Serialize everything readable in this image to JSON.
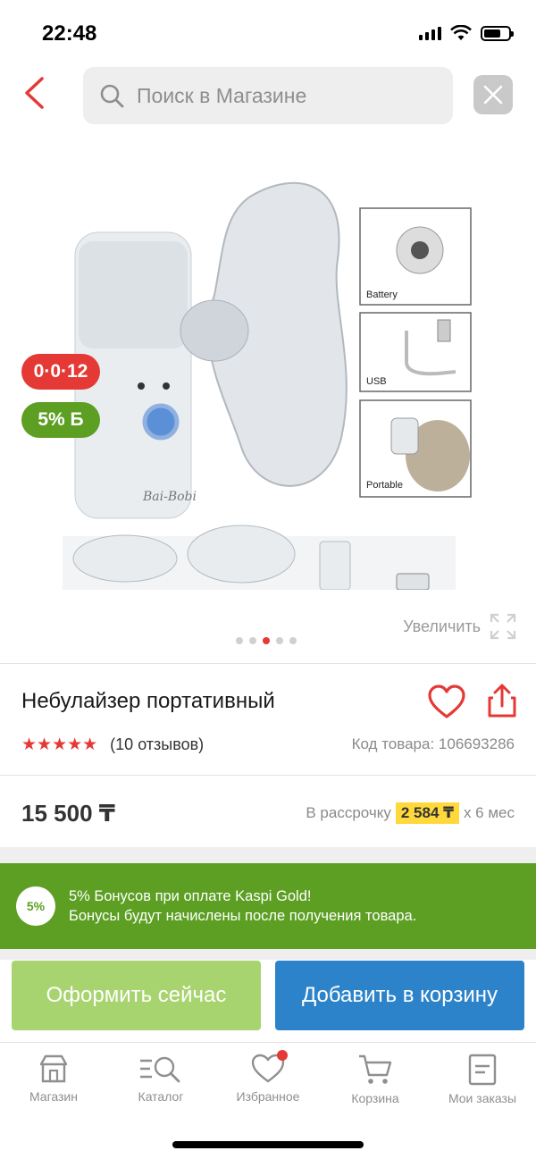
{
  "status_bar": {
    "time": "22:48"
  },
  "search": {
    "placeholder": "Поиск в Магазине"
  },
  "gallery": {
    "badge_installment": "0·0·12",
    "badge_bonus": "5% Б",
    "zoom_label": "Увеличить",
    "dots_total": 5,
    "dots_active": 3,
    "image_captions": [
      "Battery",
      "USB",
      "Portable"
    ],
    "brand_text": "Bai-Bobi"
  },
  "product": {
    "title": "Небулайзер портативный",
    "stars": "★★★★★",
    "reviews": "(10 отзывов)",
    "sku": "Код товара: 106693286",
    "price": "15 500 ₸",
    "installment_prefix": "В рассрочку",
    "installment_amount": "2 584 ₸",
    "installment_suffix": "x 6 мес"
  },
  "promo": {
    "badge": "5%",
    "line1": "5% Бонусов при оплате Kaspi Gold!",
    "line2": "Бонусы будут начислены после получения товара."
  },
  "actions": {
    "checkout": "Оформить сейчас",
    "add_to_cart": "Добавить в корзину"
  },
  "nav": [
    {
      "label": "Магазин",
      "icon": "shop-icon"
    },
    {
      "label": "Каталог",
      "icon": "catalog-icon"
    },
    {
      "label": "Избранное",
      "icon": "heart-icon"
    },
    {
      "label": "Корзина",
      "icon": "cart-icon"
    },
    {
      "label": "Мои заказы",
      "icon": "orders-icon"
    }
  ],
  "colors": {
    "accent_red": "#e53935",
    "green": "#5c9f22",
    "blue": "#2d83c9",
    "light_green": "#a8d46f",
    "highlight_yellow": "#ffd93b"
  }
}
